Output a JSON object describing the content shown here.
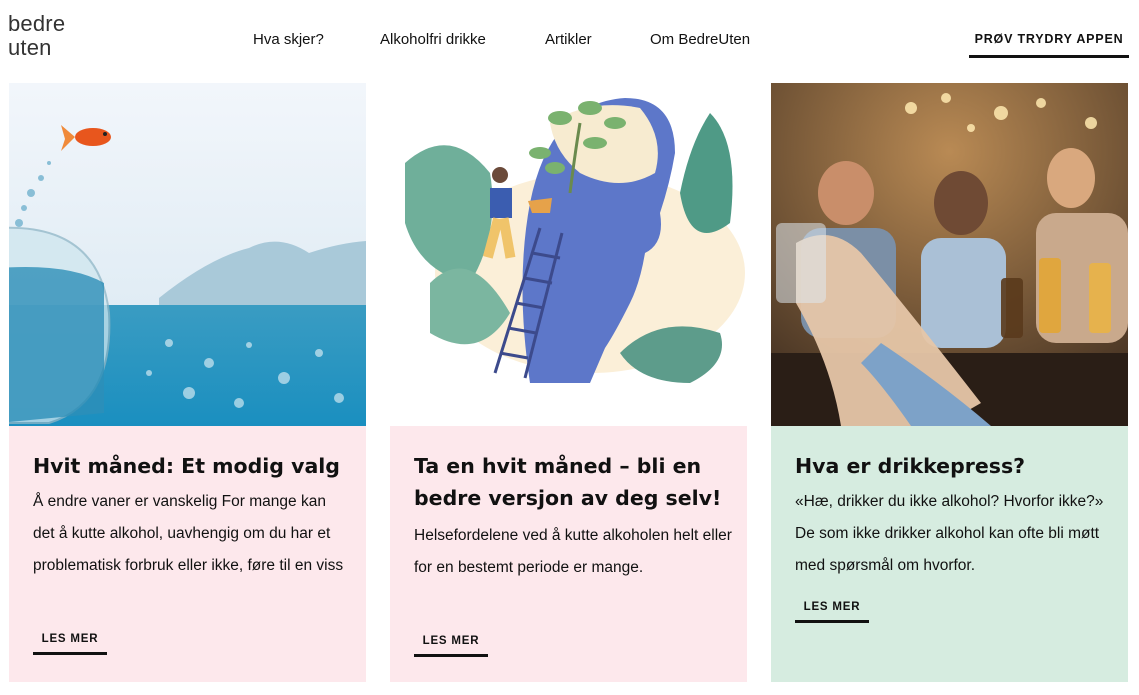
{
  "logo": {
    "line1": "bedre",
    "line2": "uten"
  },
  "nav": {
    "items": [
      {
        "label": "Hva skjer?"
      },
      {
        "label": "Alkoholfri drikke"
      },
      {
        "label": "Artikler"
      },
      {
        "label": "Om BedreUten"
      }
    ]
  },
  "cta": {
    "label": "PRØV TRYDRY APPEN"
  },
  "cards": [
    {
      "title": "Hvit måned: Et modig valg",
      "text": "Å endre vaner er vanskelig  For mange kan det å kutte alkohol, uavhengig om du har et problematisk forbruk eller ikke, føre til en viss",
      "link": "LES MER",
      "bg_color": "#fde8ec"
    },
    {
      "title": "Ta en hvit måned – bli en bedre versjon av deg selv!",
      "text": "Helsefordelene ved å kutte alkoholen helt eller for en bestemt periode er mange.",
      "link": "LES MER",
      "bg_color": "#fde8ec"
    },
    {
      "title": "Hva er drikkepress?",
      "text": "«Hæ, drikker du ikke alkohol? Hvorfor ikke?» De som ikke drikker alkohol kan ofte bli møtt med spørsmål om hvorfor.",
      "link": "LES MER",
      "bg_color": "#d6ece0"
    }
  ]
}
